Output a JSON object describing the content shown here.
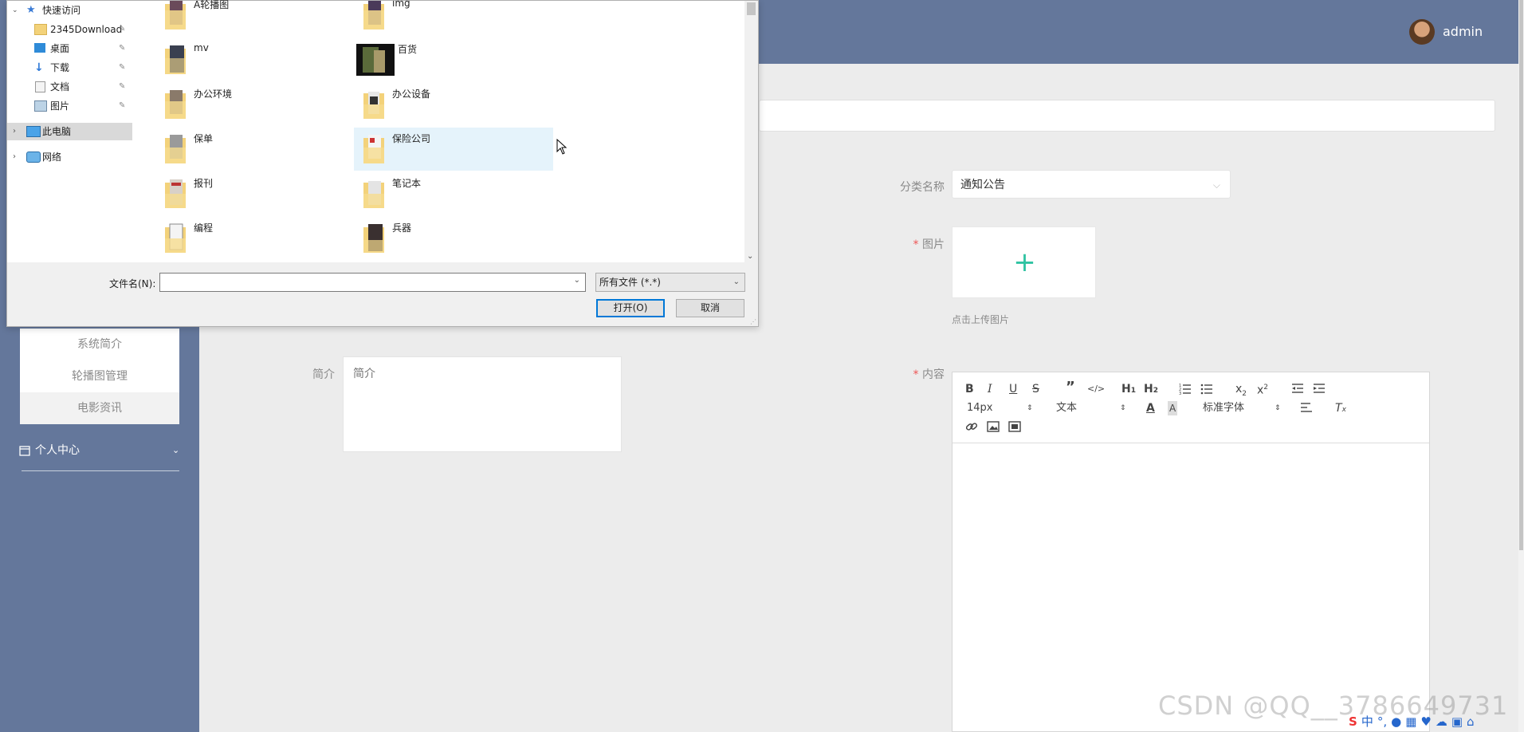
{
  "app": {
    "user_name": "admin",
    "sidebar_submenu": [
      "系统简介",
      "轮播图管理",
      "电影资讯"
    ],
    "sidebar_menu_personal": "个人中心"
  },
  "form": {
    "category_label": "分类名称",
    "category_value": "通知公告",
    "image_label": "图片",
    "upload_hint": "点击上传图片",
    "summary_label": "简介",
    "summary_placeholder": "简介",
    "content_label": "内容"
  },
  "editor": {
    "font_size": "14px",
    "block_format": "文本",
    "font_family": "标准字体"
  },
  "dialog": {
    "nav_items": [
      {
        "label": "快速访问"
      },
      {
        "label": "2345Download"
      },
      {
        "label": "桌面"
      },
      {
        "label": "下载"
      },
      {
        "label": "文档"
      },
      {
        "label": "图片"
      },
      {
        "label": "此电脑"
      },
      {
        "label": "网络"
      }
    ],
    "files": [
      "A轮播图",
      "img",
      "mv",
      "百货",
      "办公环境",
      "办公设备",
      "保单",
      "保险公司",
      "报刊",
      "笔记本",
      "编程",
      "兵器"
    ],
    "filename_label": "文件名(N):",
    "filename_value": "",
    "filetype_value": "所有文件 (*.*)",
    "open_button": "打开(O)",
    "cancel_button": "取消"
  },
  "watermark": "CSDN @QQ__3786649731",
  "tray": {
    "ime_label": "中"
  },
  "colors": {
    "topbar": "#64779b",
    "accent": "#2fc3a2",
    "required": "#e55555"
  }
}
